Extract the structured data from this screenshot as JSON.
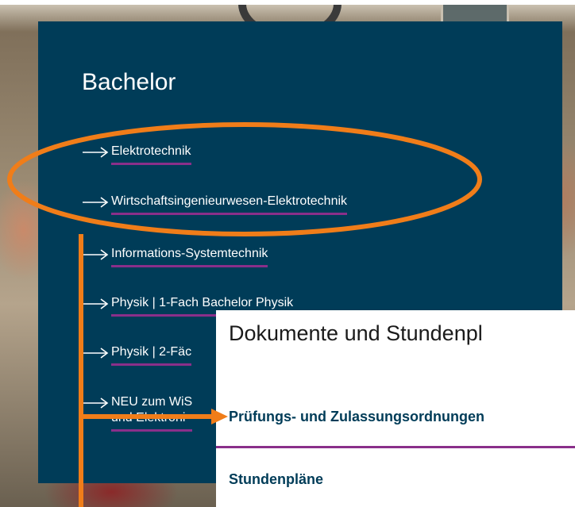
{
  "panel": {
    "title": "Bachelor",
    "links": [
      {
        "label": "Elektrotechnik"
      },
      {
        "label": "Wirtschaftsingenieurwesen-Elektrotechnik"
      },
      {
        "label": "Informations-Systemtechnik"
      },
      {
        "label": "Physik | 1-Fach Bachelor Physik"
      },
      {
        "label": "Physik | 2-Fäc"
      },
      {
        "label": "NEU zum WiS",
        "label2": "und Elektroni"
      }
    ]
  },
  "overlay": {
    "title": "Dokumente und Stundenpl",
    "link1": "Prüfungs- und Zulassungsordnungen",
    "link2": "Stundenpläne"
  },
  "colors": {
    "panel_bg": "#003c58",
    "link_underline": "#8a2f8a",
    "annotation": "#f07d19",
    "overlay_link": "#003c58"
  },
  "icons": {
    "link_arrow": "right-arrow-icon"
  }
}
